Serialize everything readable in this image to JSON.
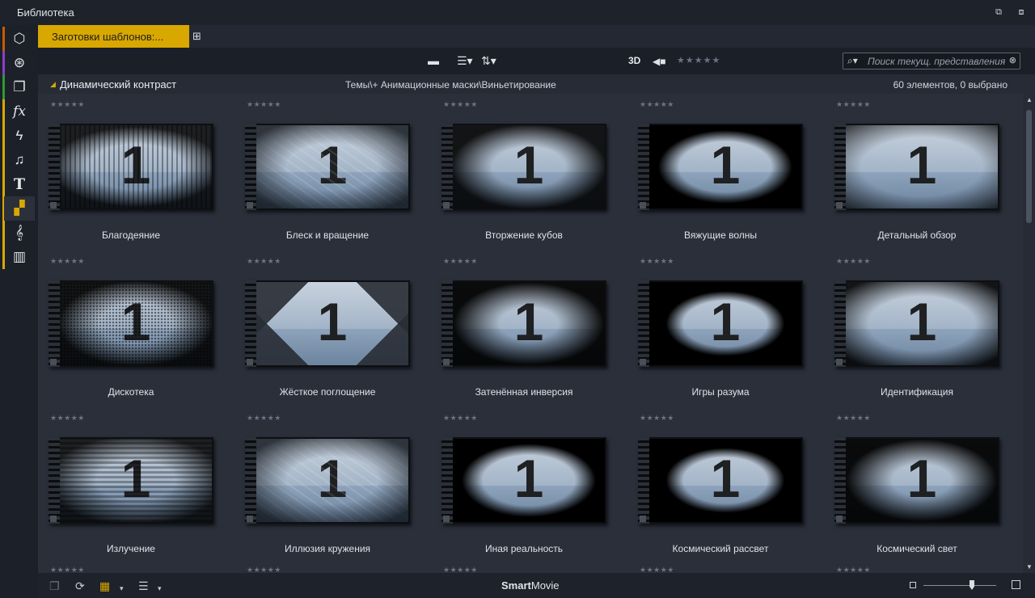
{
  "window": {
    "title": "Библиотека",
    "restore_icon": "restore-window-icon",
    "dock_icon": "dock-icon"
  },
  "sidebar": {
    "items": [
      {
        "name": "project-bin",
        "icon": "box-icon",
        "glyph": "⬡",
        "stripe": "#c85a00"
      },
      {
        "name": "film-reel",
        "icon": "film-reel-icon",
        "glyph": "⊛",
        "stripe": "#8a3fc8"
      },
      {
        "name": "collections",
        "icon": "stack-icon",
        "glyph": "❐",
        "stripe": "#2f9a33"
      },
      {
        "name": "effects",
        "icon": "fx-icon",
        "glyph": "fx",
        "stripe": "#d8a800"
      },
      {
        "name": "transitions",
        "icon": "lightning-icon",
        "glyph": "ϟ",
        "stripe": "#d8a800"
      },
      {
        "name": "music",
        "icon": "music-note-icon",
        "glyph": "♫",
        "stripe": "#d8a800"
      },
      {
        "name": "titles",
        "icon": "title-t-icon",
        "glyph": "T",
        "stripe": "#d8a800"
      },
      {
        "name": "templates",
        "icon": "template-icon",
        "glyph": "▞",
        "stripe": "#d8a800",
        "active": true
      },
      {
        "name": "score",
        "icon": "treble-clef-icon",
        "glyph": "𝄞",
        "stripe": "#d8a800"
      },
      {
        "name": "piano",
        "icon": "piano-icon",
        "glyph": "▥",
        "stripe": "#d8a800"
      }
    ]
  },
  "tabs": {
    "active_label": "Заготовки шаблонов:...",
    "add_icon": "add-tab-icon"
  },
  "toolbar": {
    "folder_icon": "folder-icon",
    "list_icon": "list-view-icon",
    "sort_icon": "sort-icon",
    "three_d_label": "3D",
    "tag_icon": "tag-icon",
    "rating_stars": "★★★★★",
    "search": {
      "placeholder": "Поиск текущ. представления",
      "icon": "search-icon",
      "clear_icon": "clear-icon"
    }
  },
  "content": {
    "category": "Динамический контраст",
    "path": "Темы\\+ Анимационные маски\\Виньетирование",
    "count": "60 элементов, 0 выбрано",
    "top_stars": "★★★★★",
    "items": [
      {
        "name": "Благодеяние",
        "stars": "★★★★★",
        "digit": "1",
        "style": "burst"
      },
      {
        "name": "Блеск и вращение",
        "stars": "★★★★★",
        "digit": "1",
        "style": "swirl"
      },
      {
        "name": "Вторжение кубов",
        "stars": "★★★★★",
        "digit": "1",
        "style": "cubes"
      },
      {
        "name": "Вяжущие волны",
        "stars": "★★★★★",
        "digit": "1",
        "style": "oval"
      },
      {
        "name": "Детальный обзор",
        "stars": "★★★★★",
        "digit": "1",
        "style": "room"
      },
      {
        "name": "Дискотека",
        "stars": "★★★★★",
        "digit": "1",
        "style": "dots"
      },
      {
        "name": "Жёсткое поглощение",
        "stars": "★★★★★",
        "digit": "1",
        "style": "diamond"
      },
      {
        "name": "Затенённая инверсия",
        "stars": "★★★★★",
        "digit": "1",
        "style": "rays"
      },
      {
        "name": "Игры разума",
        "stars": "★★★★★",
        "digit": "1",
        "style": "splash"
      },
      {
        "name": "Идентификация",
        "stars": "★★★★★",
        "digit": "1",
        "style": "glow"
      },
      {
        "name": "Излучение",
        "stars": "★★★★★",
        "digit": "1",
        "style": "pixel"
      },
      {
        "name": "Иллюзия кружения",
        "stars": "★★★★★",
        "digit": "1",
        "style": "swirl"
      },
      {
        "name": "Иная реальность",
        "stars": "★★★★★",
        "digit": "1",
        "style": "oval"
      },
      {
        "name": "Космический рассвет",
        "stars": "★★★★★",
        "digit": "1",
        "style": "splash"
      },
      {
        "name": "Космический свет",
        "stars": "★★★★★",
        "digit": "1",
        "style": "rays"
      }
    ],
    "bottom_stars": "★★★★★"
  },
  "statusbar": {
    "smart_bold": "Smart",
    "smart_rest": "Movie",
    "zoom_value": 0.67
  }
}
